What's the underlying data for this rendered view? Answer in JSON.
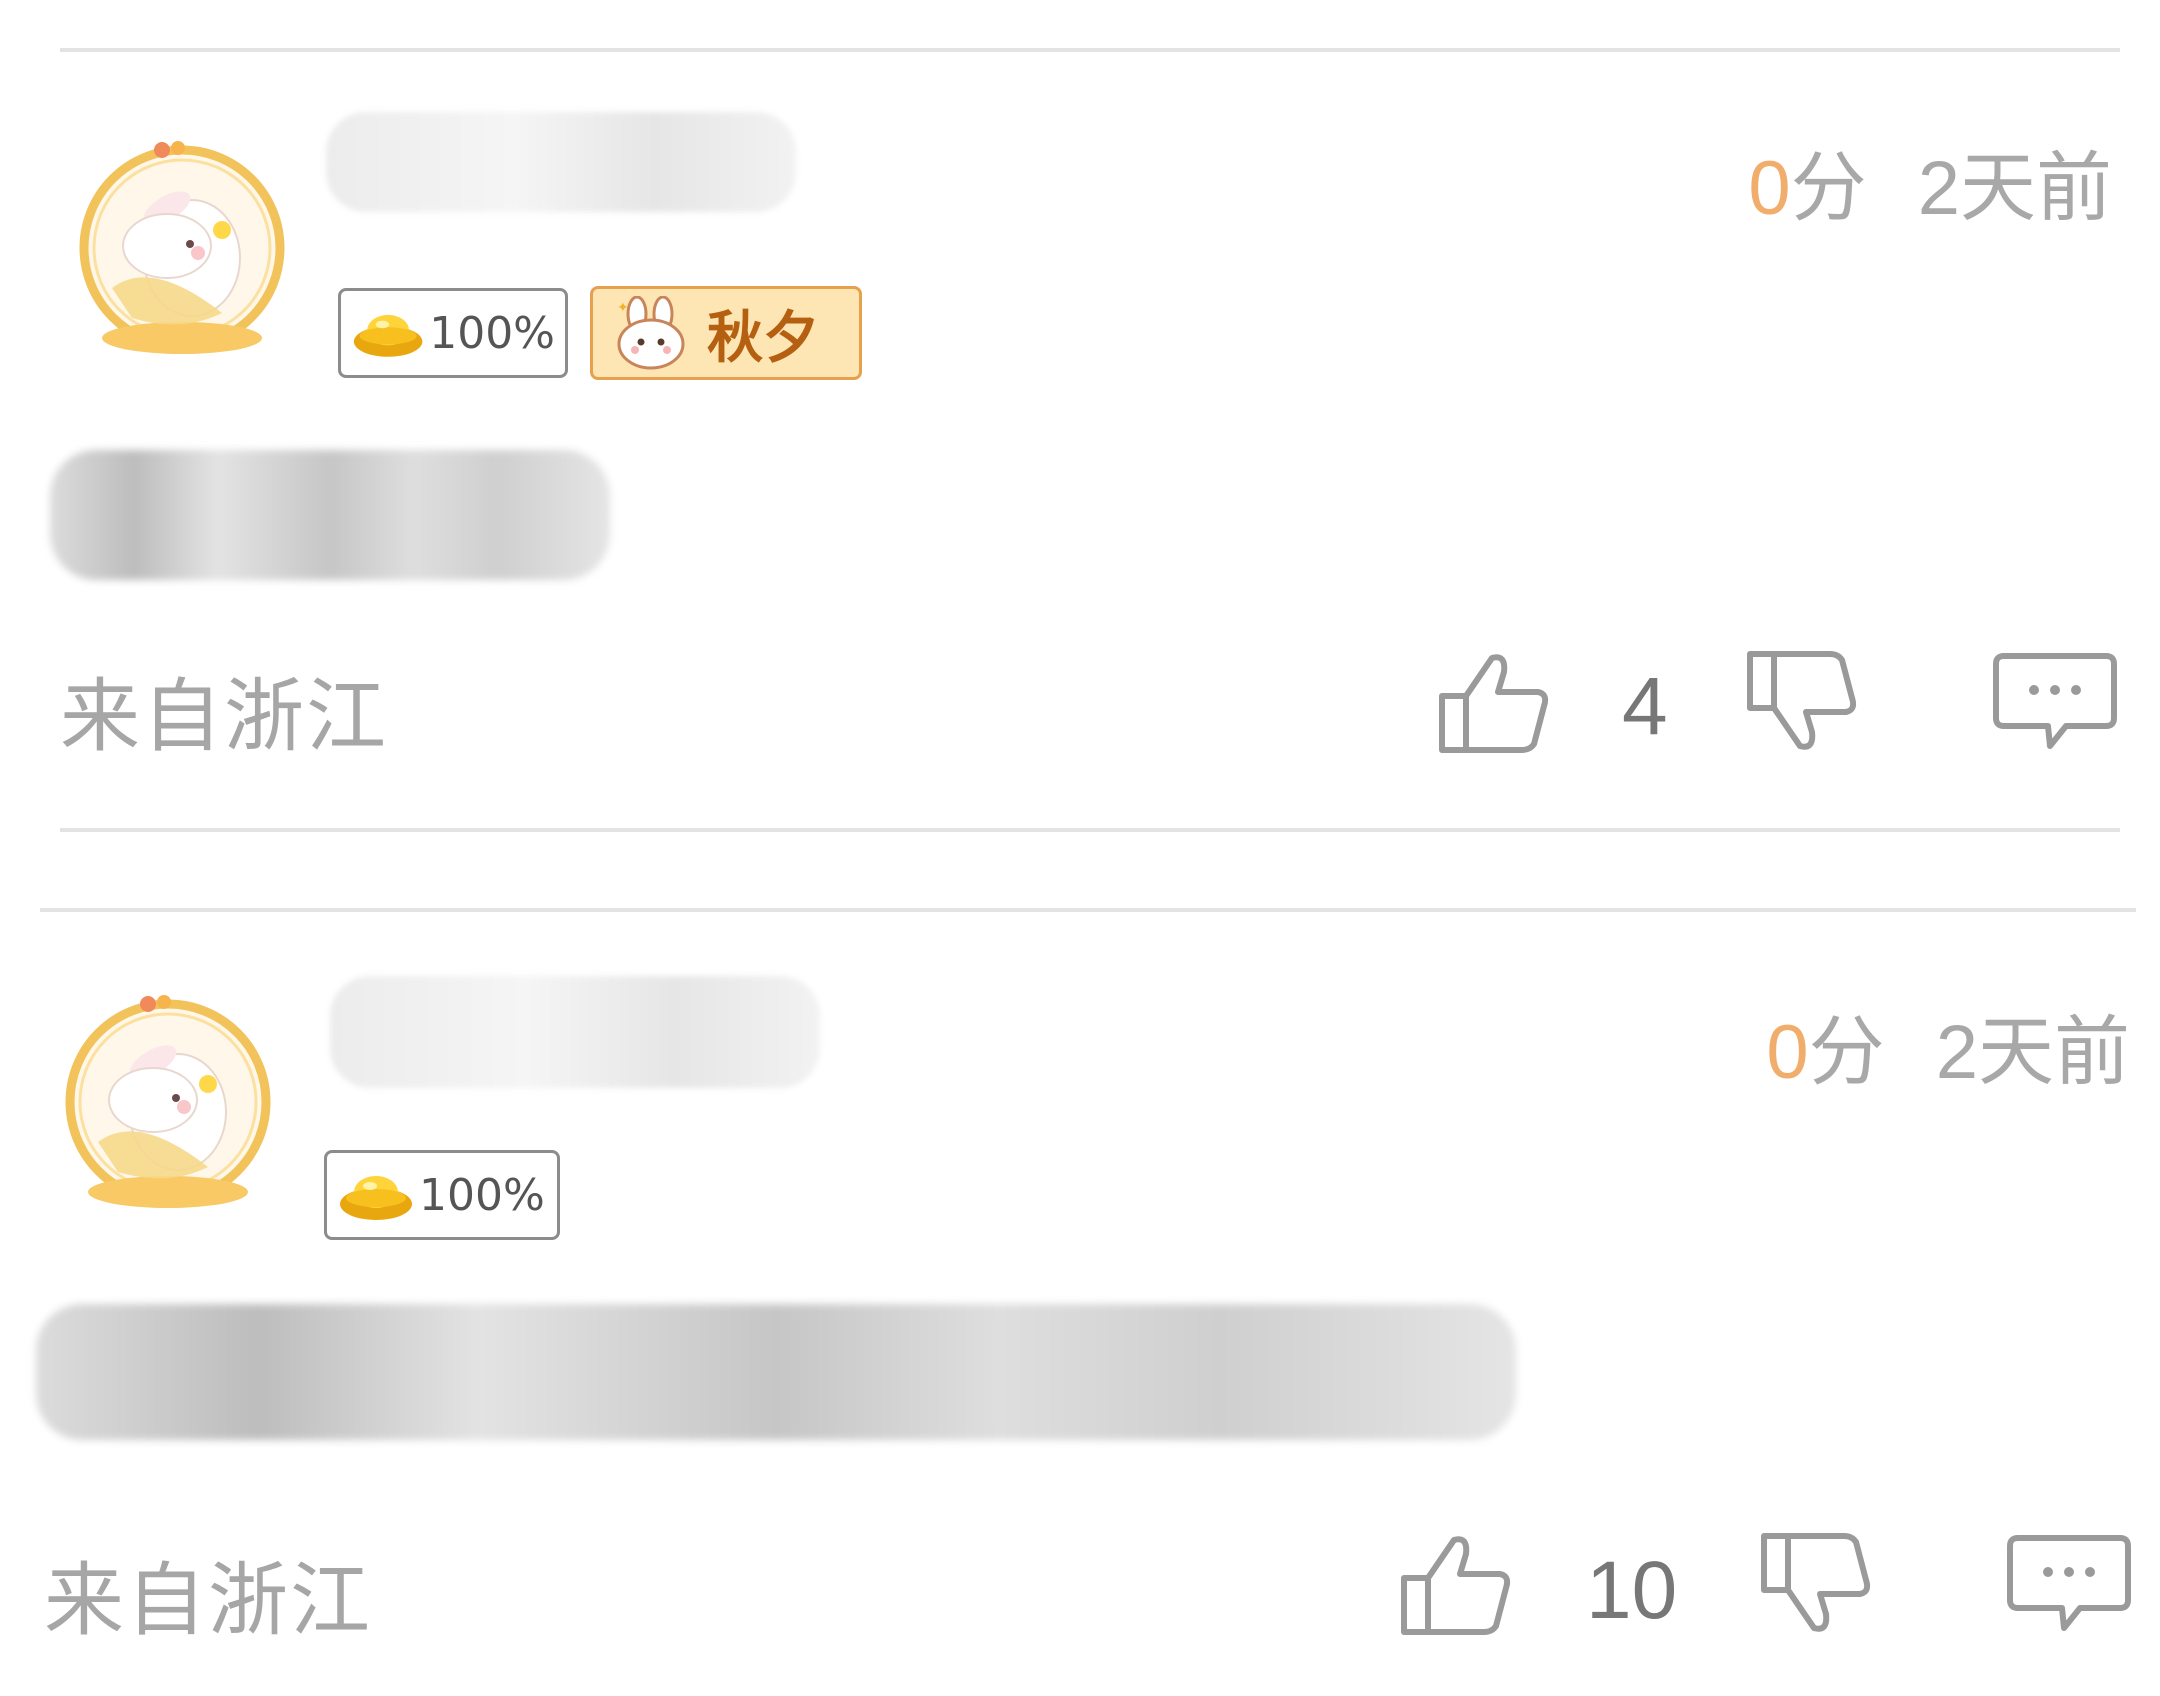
{
  "comments": [
    {
      "score": "0",
      "score_unit": "分",
      "time": "2天前",
      "coin_badge": "100%",
      "season_badge": "秋夕",
      "location": "来自浙江",
      "like_count": "4"
    },
    {
      "score": "0",
      "score_unit": "分",
      "time": "2天前",
      "coin_badge": "100%",
      "location": "来自浙江",
      "like_count": "10"
    }
  ],
  "icons": {
    "like": "thumbs-up-icon",
    "dislike": "thumbs-down-icon",
    "reply": "comment-bubble-icon",
    "coin": "gold-ingot-icon",
    "season": "rabbit-icon"
  },
  "colors": {
    "score_accent": "#f0ad6c",
    "season_badge_bg": "#fde6b4",
    "season_badge_text": "#b55f10",
    "divider": "#e3e3e3"
  }
}
